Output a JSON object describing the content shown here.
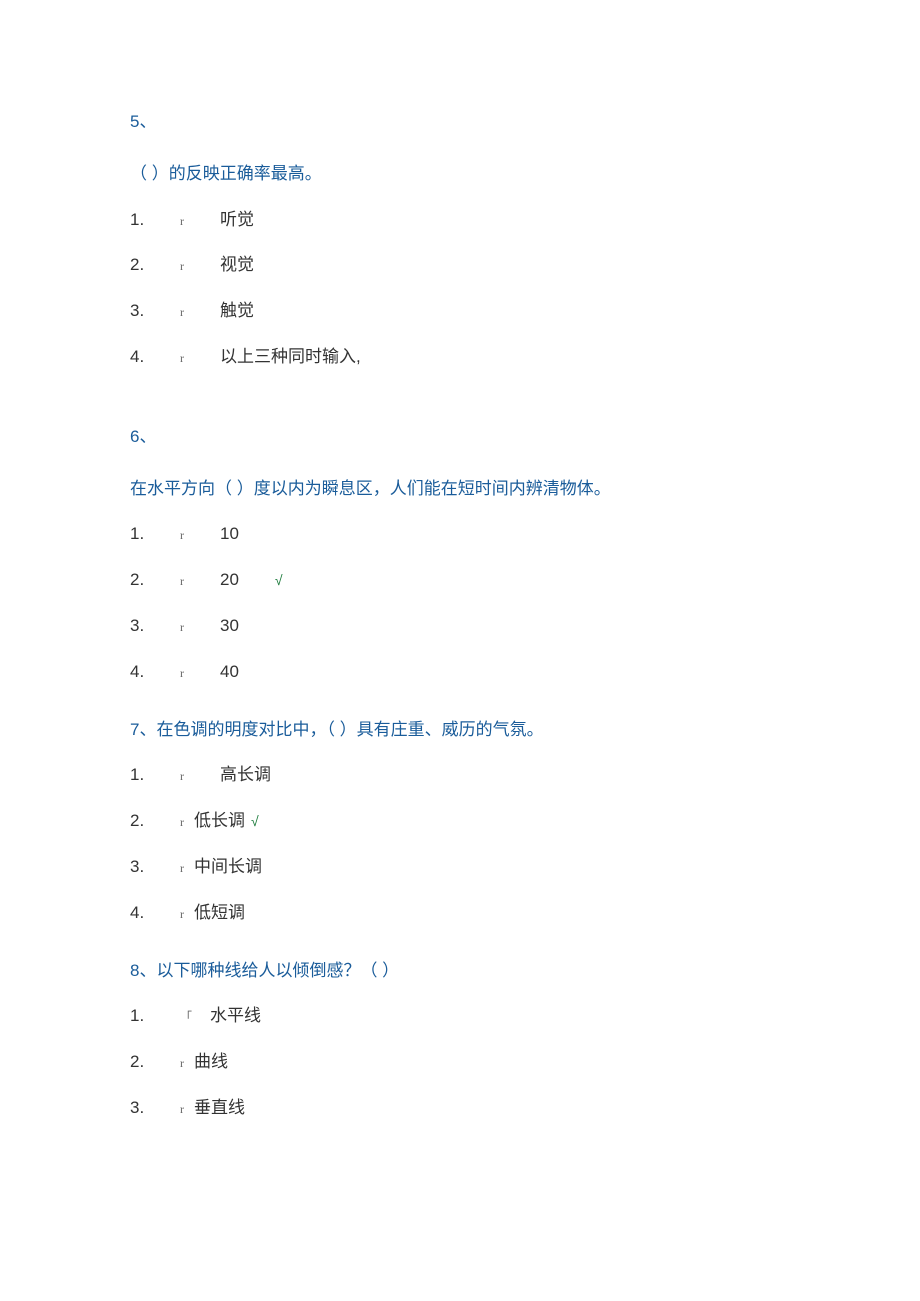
{
  "q5": {
    "num": "5、",
    "text": "（          ）的反映正确率最高。",
    "options": [
      {
        "n": "1.",
        "r": "r",
        "t": "听觉"
      },
      {
        "n": "2.",
        "r": "r",
        "t": "视觉"
      },
      {
        "n": "3.",
        "r": "r",
        "t": "触觉"
      },
      {
        "n": "4.",
        "r": "r",
        "t": "以上三种同时输入,"
      }
    ]
  },
  "q6": {
    "num": "6、",
    "text": "在水平方向（          ）度以内为瞬息区，人们能在短时间内辨清物体。",
    "options": [
      {
        "n": "1.",
        "r": "r",
        "t": "10",
        "mark": ""
      },
      {
        "n": "2.",
        "r": "r",
        "t": "20",
        "mark": "√"
      },
      {
        "n": "3.",
        "r": "r",
        "t": "30",
        "mark": ""
      },
      {
        "n": "4.",
        "r": "r",
        "t": "40",
        "mark": ""
      }
    ]
  },
  "q7": {
    "text": "7、在色调的明度对比中，（              ）具有庄重、威历的气氛。",
    "options": [
      {
        "n": "1.",
        "r": "r",
        "t": "高长调",
        "mark": "",
        "wide": true
      },
      {
        "n": "2.",
        "r": "r",
        "t": "低长调",
        "mark": "√",
        "wide": false
      },
      {
        "n": "3.",
        "r": "r",
        "t": "中间长调",
        "mark": "",
        "wide": false
      },
      {
        "n": "4.",
        "r": "r",
        "t": "低短调",
        "mark": "",
        "wide": false
      }
    ]
  },
  "q8": {
    "text": "8、以下哪种线给人以倾倒感？（                ）",
    "options": [
      {
        "n": "1.",
        "r": "「",
        "t": "水平线",
        "wide": true
      },
      {
        "n": "2.",
        "r": "r",
        "t": "曲线",
        "wide": false
      },
      {
        "n": "3.",
        "r": "r",
        "t": "垂直线",
        "wide": false
      }
    ]
  }
}
